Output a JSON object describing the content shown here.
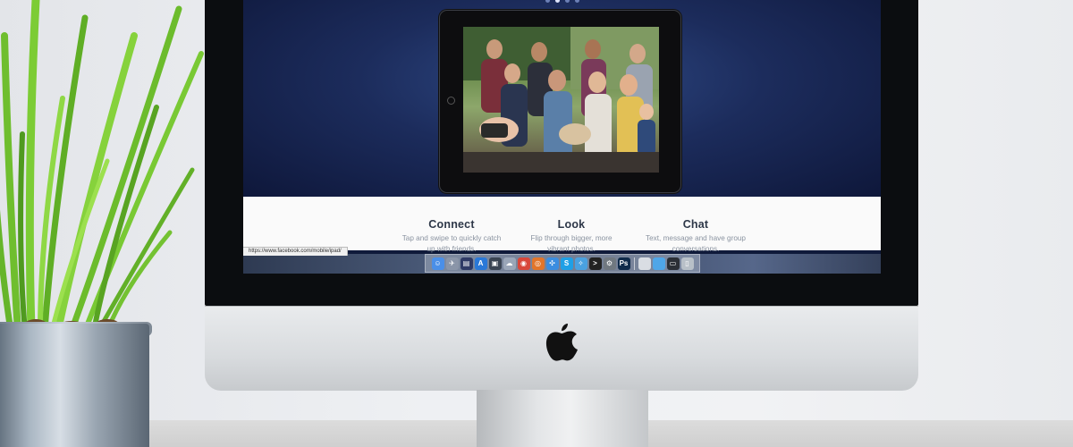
{
  "screen": {
    "features": [
      {
        "title": "Connect",
        "desc_line1": "Tap and swipe to quickly catch",
        "desc_line2": "up with friends."
      },
      {
        "title": "Look",
        "desc_line1": "Flip through bigger, more",
        "desc_line2": "vibrant photos."
      },
      {
        "title": "Chat",
        "desc_line1": "Text, message and have group",
        "desc_line2": "conversations."
      }
    ],
    "status_url": "https://www.facebook.com/mobile/ipad/"
  },
  "dock": {
    "icons": [
      {
        "name": "finder-icon",
        "color": "#4a8fe8",
        "glyph": "☺"
      },
      {
        "name": "launchpad-icon",
        "color": "#8a95a8",
        "glyph": "✈"
      },
      {
        "name": "mission-control-icon",
        "color": "#2f3a66",
        "glyph": "▤"
      },
      {
        "name": "app-store-icon",
        "color": "#2a78d8",
        "glyph": "A"
      },
      {
        "name": "photo-icon",
        "color": "#3a4452",
        "glyph": "▣"
      },
      {
        "name": "cloud-icon",
        "color": "#9aa6b8",
        "glyph": "☁"
      },
      {
        "name": "chrome-icon",
        "color": "#d8473a",
        "glyph": "◉"
      },
      {
        "name": "firefox-icon",
        "color": "#e2752a",
        "glyph": "◎"
      },
      {
        "name": "safari-icon",
        "color": "#3b8de0",
        "glyph": "✣"
      },
      {
        "name": "skype-icon",
        "color": "#1ea0e6",
        "glyph": "S"
      },
      {
        "name": "compass-icon",
        "color": "#4aa1e0",
        "glyph": "✧"
      },
      {
        "name": "terminal-icon",
        "color": "#222222",
        "glyph": ">"
      },
      {
        "name": "preferences-icon",
        "color": "#707880",
        "glyph": "⚙"
      },
      {
        "name": "photoshop-icon",
        "color": "#0f2a4a",
        "glyph": "Ps"
      },
      {
        "name": "document-icon",
        "color": "#d9dde3",
        "glyph": " "
      },
      {
        "name": "folder-icon",
        "color": "#4fa6e8",
        "glyph": " "
      },
      {
        "name": "screen-icon",
        "color": "#2b2f36",
        "glyph": "▭"
      },
      {
        "name": "trash-icon",
        "color": "#b8c0c8",
        "glyph": "▯"
      }
    ]
  }
}
